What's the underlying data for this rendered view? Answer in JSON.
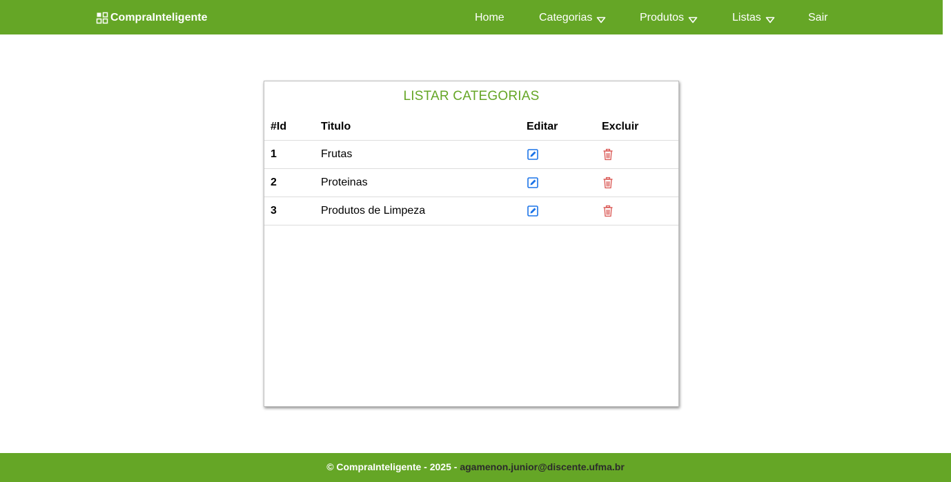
{
  "nav": {
    "brand": "CompraInteligente",
    "items": [
      {
        "label": "Home",
        "has_dropdown": false
      },
      {
        "label": "Categorias",
        "has_dropdown": true
      },
      {
        "label": "Produtos",
        "has_dropdown": true
      },
      {
        "label": "Listas",
        "has_dropdown": true
      },
      {
        "label": "Sair",
        "has_dropdown": false
      }
    ]
  },
  "card": {
    "title": "LISTAR CATEGORIAS",
    "columns": [
      "#Id",
      "Titulo",
      "Editar",
      "Excluir"
    ],
    "rows": [
      {
        "id": "1",
        "title": "Frutas"
      },
      {
        "id": "2",
        "title": "Proteinas"
      },
      {
        "id": "3",
        "title": "Produtos de Limpeza"
      }
    ]
  },
  "footer": {
    "prefix": "© CompraInteligente - 2025 - ",
    "email": "agamenon.junior@discente.ufma.br"
  },
  "icons": {
    "brand": "dashboard-grid-icon",
    "dropdown": "caret-down-icon",
    "edit": "edit-icon",
    "delete": "trash-icon"
  },
  "colors": {
    "primary": "#65a626",
    "edit_icon": "#1a73e8",
    "delete_icon": "#d9534f"
  }
}
